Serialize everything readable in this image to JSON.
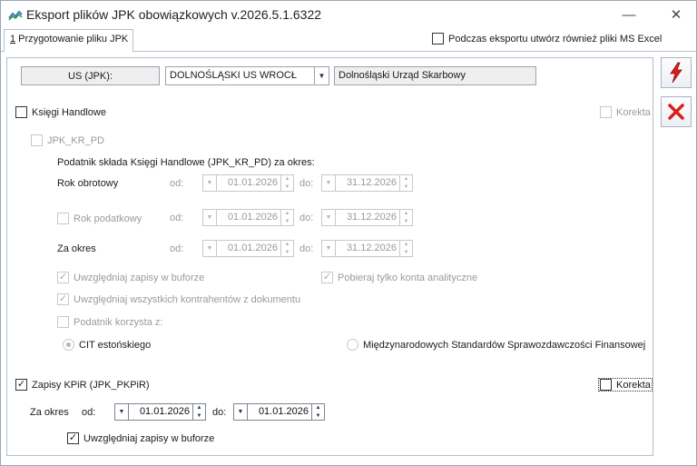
{
  "window": {
    "title": "Eksport plików JPK obowiązkowych v.2026.5.1.6322",
    "minimize": "—",
    "close": "✕"
  },
  "tab": {
    "hotkey": "1",
    "label": " Przygotowanie pliku JPK"
  },
  "excel_option": {
    "label": "Podczas eksportu utwórz również pliki MS Excel",
    "checked": false
  },
  "us": {
    "label": "US (JPK):",
    "selected": "DOLNOŚLĄSKI US WROCŁ",
    "full_name": "Dolnośląski Urząd Skarbowy"
  },
  "kh": {
    "label": "Księgi Handlowe",
    "correction": "Korekta",
    "jpk_label": "JPK_KR_PD",
    "period_text": "Podatnik składa Księgi Handlowe (JPK_KR_PD) za okres:",
    "rows": [
      {
        "label": "Rok obrotowy",
        "od": "od:",
        "from": "01.01.2026",
        "do": "do:",
        "to": "31.12.2026"
      },
      {
        "label": "Rok podatkowy",
        "od": "od:",
        "from": "01.01.2026",
        "do": "do:",
        "to": "31.12.2026"
      },
      {
        "label": "Za okres",
        "od": "od:",
        "from": "01.01.2026",
        "do": "do:",
        "to": "31.12.2026"
      }
    ],
    "opt_bufor": "Uwzględniaj zapisy w buforze",
    "opt_analytic": "Pobieraj tylko konta analityczne",
    "opt_contractors": "Uwzględniaj wszystkich kontrahentów z dokumentu",
    "opt_taxpayer": "Podatnik korzysta z:",
    "radio_cit": "CIT estońskiego",
    "radio_msr": "Międzynarodowych Standardów Sprawozdawczości Finansowej"
  },
  "kpir": {
    "label": "Zapisy KPiR (JPK_PKPiR)",
    "correction": "Korekta",
    "period_label": "Za okres",
    "od": "od:",
    "from": "01.01.2026",
    "do": "do:",
    "to": "01.01.2026",
    "bufor": "Uwzględniaj zapisy w buforze"
  },
  "icons": {
    "export": "lightning-icon",
    "cancel": "red-x-icon",
    "accent_red": "#d81e1e"
  }
}
